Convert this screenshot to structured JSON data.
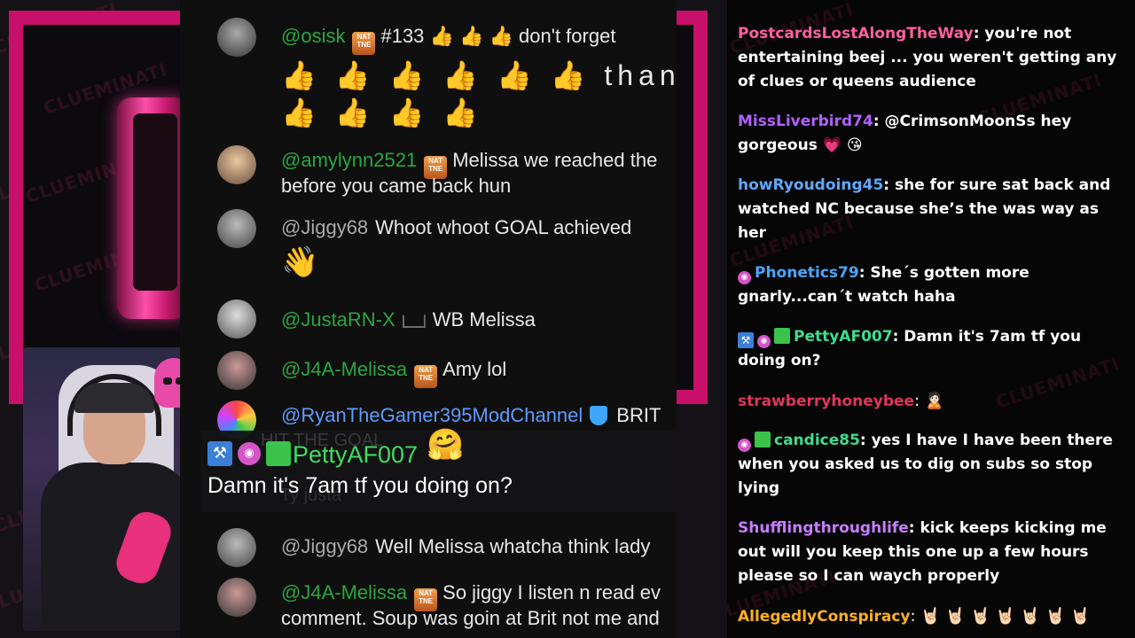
{
  "watermark": "CLUEMINATI",
  "youtube_chat": {
    "messages": [
      {
        "user": "@osisk",
        "badge": "NAT TNE",
        "text": "#133 👍 👍 👍 don't forget",
        "line2": "👍 👍 👍 👍 👍 👍  thank you 👍",
        "line3": "👍 👍 👍 👍"
      },
      {
        "user": "@amylynn2521",
        "badge": "NAT TNE",
        "text": "Melissa we reached the",
        "line2": "before you came back hun"
      },
      {
        "user": "@Jiggy68",
        "text": "Whoot whoot GOAL achieved",
        "line2_emoji": "👋"
      },
      {
        "user": "@JustaRN-X",
        "text": "WB Melissa"
      },
      {
        "user": "@J4A-Melissa",
        "badge": "NAT TNE",
        "text": "Amy lol"
      },
      {
        "user": "@RyanTheGamer395ModChannel",
        "text": "BRIT"
      },
      {
        "user": "@Jiggy68",
        "text": "Well Melissa whatcha think lady"
      },
      {
        "user": "@J4A-Melissa",
        "badge": "NAT TNE",
        "text": "So jiggy I listen n read ev",
        "line2": "comment. Soup was goin at Brit not me and"
      }
    ],
    "ghost_text_top": "HIT THE GOAL",
    "ghost_text_bottom": "Ty justa"
  },
  "featured": {
    "user": "PettyAF007",
    "message": "Damn it's 7am tf you doing on?",
    "emoji": "🤗"
  },
  "twitch_chat": [
    {
      "user": "PostcardsLostAlongTheWay",
      "color": "#ff5fa2",
      "text": ": you're not entertaining beej ... you weren't getting any of clues or queens audience"
    },
    {
      "user": "MissLiverbird74",
      "color": "#b061ff",
      "text": ": @CrimsonMoonSs hey gorgeous 💗 😘"
    },
    {
      "user": "howRyoudoing45",
      "color": "#5fa8ff",
      "text": ": she for sure sat back and watched NC because she’s the was way as her"
    },
    {
      "user": "Phonetics79",
      "color": "#4aa6ff",
      "text": ": She´s gotten more gnarly...can´t watch haha"
    },
    {
      "user": "PettyAF007",
      "color": "#3fdc8c",
      "text": ": Damn it's 7am tf you doing on?"
    },
    {
      "user": "strawberryhoneybee",
      "color": "#e0365a",
      "text": ": 🙎🏻"
    },
    {
      "user": "candice85",
      "color": "#3fdc8c",
      "text": ": yes I have I have been there when you asked us to dig on subs so stop lying"
    },
    {
      "user": "Shufflingthroughlife",
      "color": "#c77dff",
      "text": ": kick keeps kicking me out will you keep this one up a few hours please so I can waych properly"
    },
    {
      "user": "AllegedlyConspiracy",
      "color": "#ffb020",
      "text": ": 🤘🏻 🤘🏻 🤘🏻 🤘🏻 🤘🏻 🤘🏻 🤘🏻"
    }
  ]
}
